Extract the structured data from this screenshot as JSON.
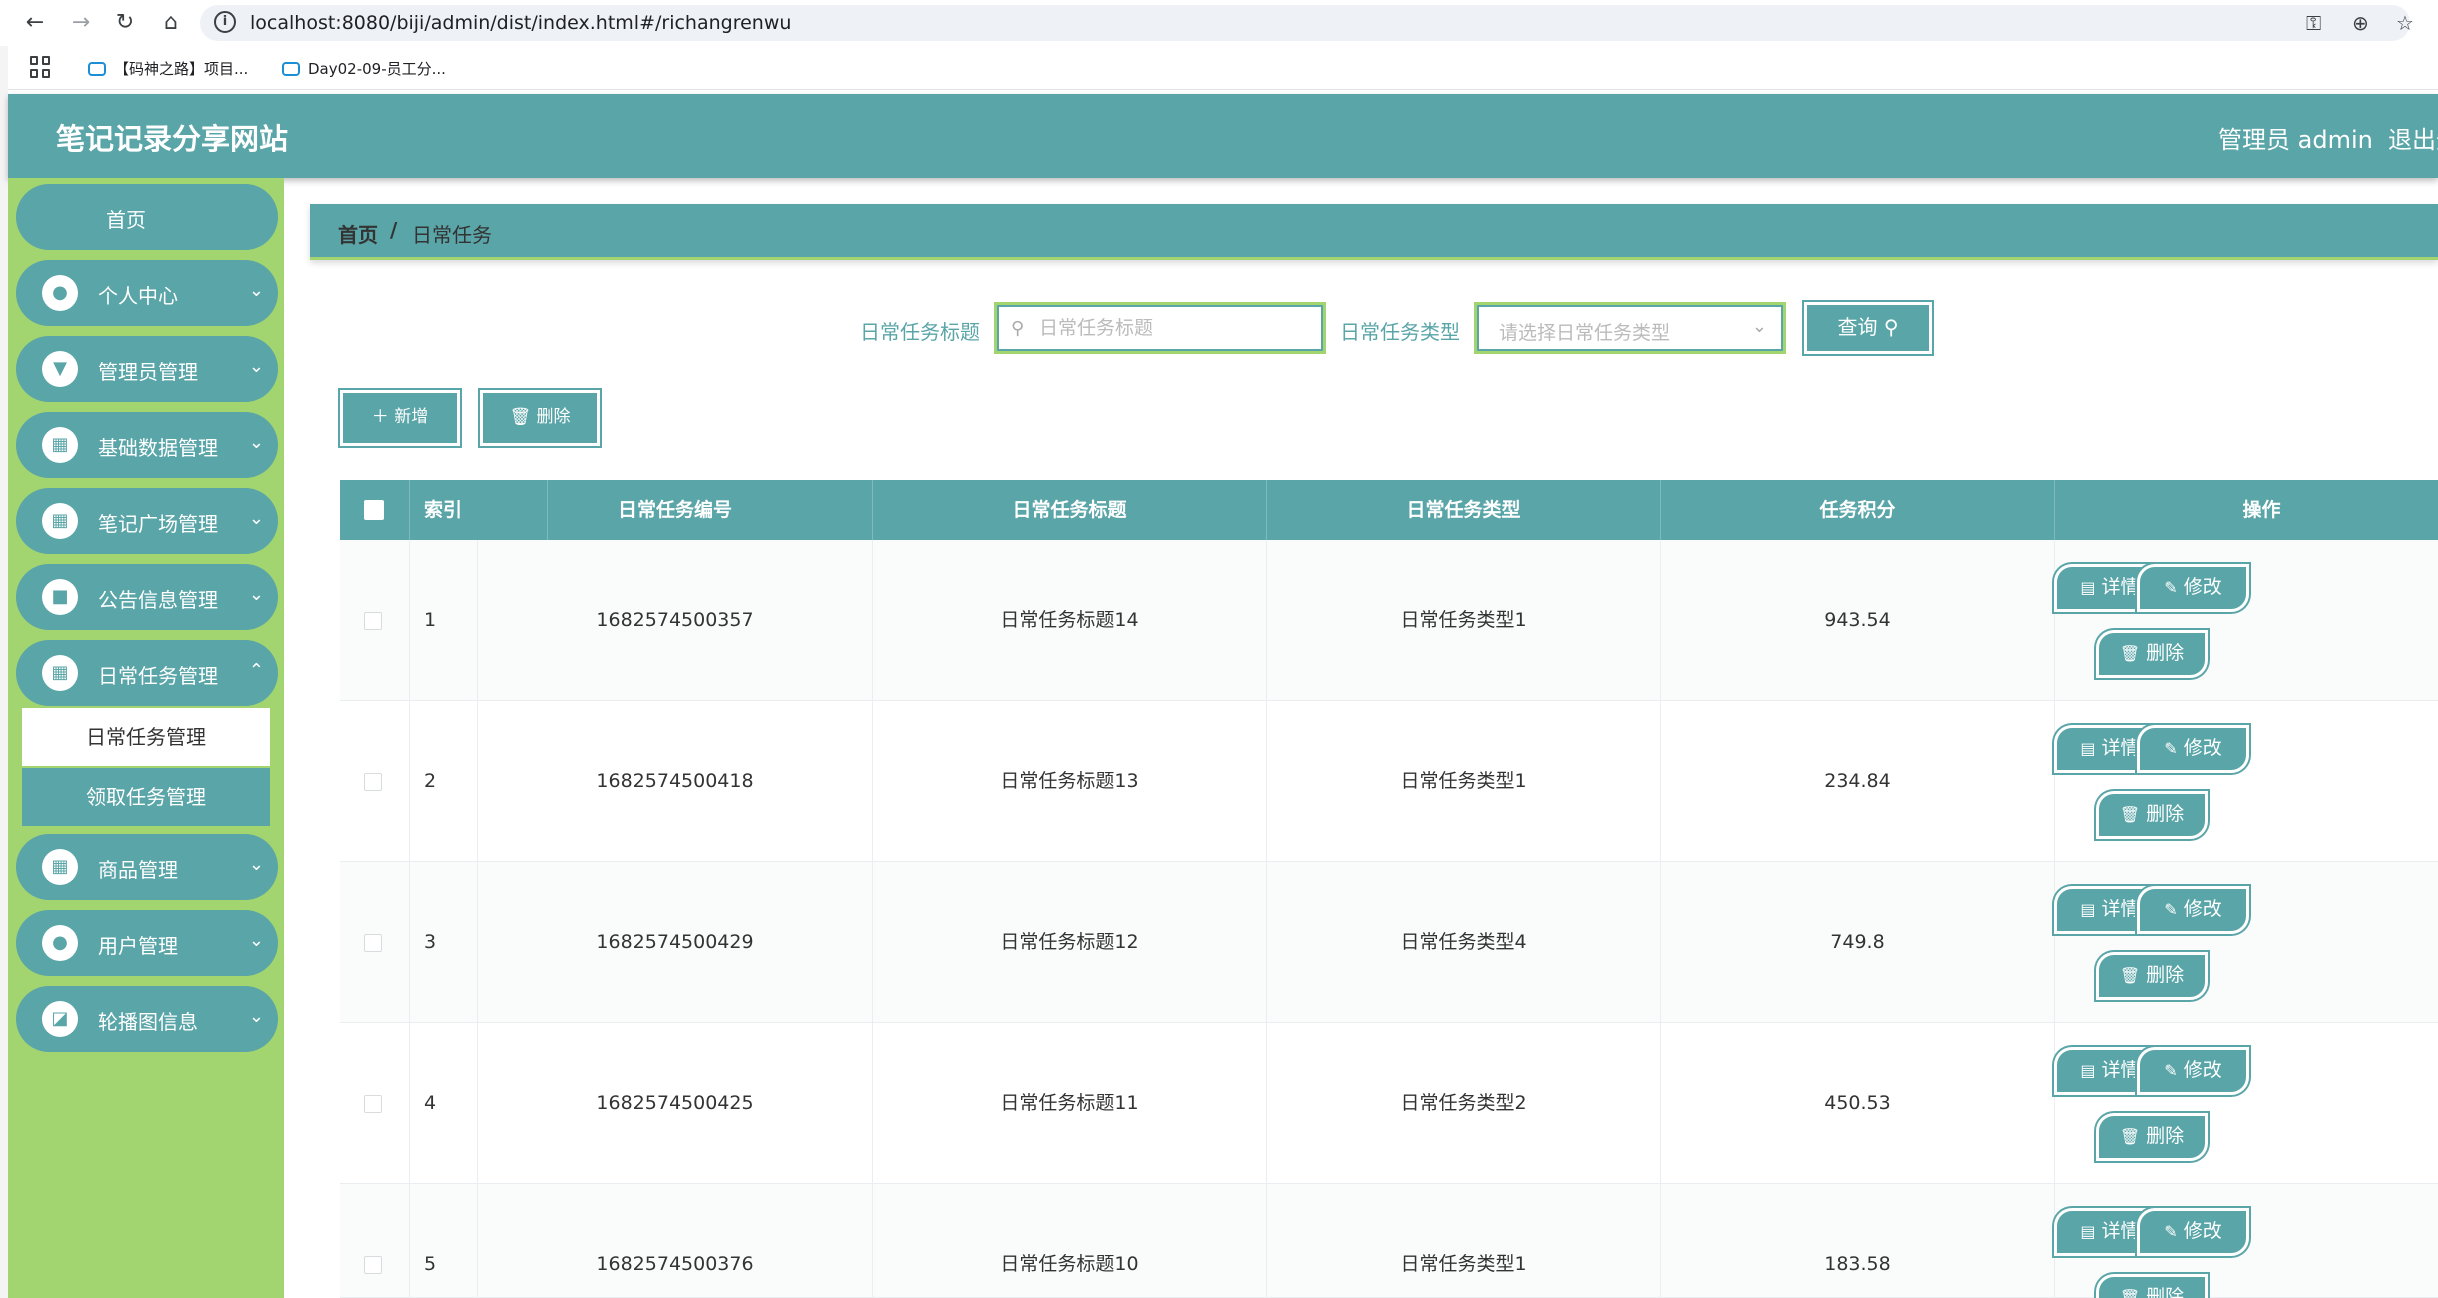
{
  "browser": {
    "url": "localhost:8080/biji/admin/dist/index.html#/richangrenwu",
    "bookmarks": [
      "【码神之路】项目...",
      "Day02-09-员工分..."
    ]
  },
  "header": {
    "site_title": "笔记记录分享网站",
    "admin_label": "管理员 admin",
    "logout": "退出登录"
  },
  "sidebar": {
    "home": "首页",
    "items": [
      {
        "label": "个人中心",
        "icon": "user-icon"
      },
      {
        "label": "管理员管理",
        "icon": "admin-icon"
      },
      {
        "label": "基础数据管理",
        "icon": "grid-icon"
      },
      {
        "label": "笔记广场管理",
        "icon": "grid-icon"
      },
      {
        "label": "公告信息管理",
        "icon": "notice-icon"
      },
      {
        "label": "日常任务管理",
        "icon": "grid-icon"
      },
      {
        "label": "商品管理",
        "icon": "grid-icon"
      },
      {
        "label": "用户管理",
        "icon": "user-icon"
      },
      {
        "label": "轮播图信息",
        "icon": "chart-icon"
      }
    ],
    "sub_items": [
      {
        "label": "日常任务管理",
        "active": true
      },
      {
        "label": "领取任务管理",
        "active": false
      }
    ]
  },
  "breadcrumb": {
    "home": "首页",
    "separator": "/",
    "current": "日常任务"
  },
  "search": {
    "title_label": "日常任务标题",
    "title_placeholder": "日常任务标题",
    "type_label": "日常任务类型",
    "type_placeholder": "请选择日常任务类型",
    "query_button": "查询"
  },
  "actions": {
    "add": "新增",
    "delete": "删除"
  },
  "table": {
    "columns": [
      "索引",
      "日常任务编号",
      "日常任务标题",
      "日常任务类型",
      "任务积分",
      "操作"
    ],
    "rows": [
      {
        "index": "1",
        "code": "1682574500357",
        "title": "日常任务标题14",
        "type": "日常任务类型1",
        "points": "943.54"
      },
      {
        "index": "2",
        "code": "1682574500418",
        "title": "日常任务标题13",
        "type": "日常任务类型1",
        "points": "234.84"
      },
      {
        "index": "3",
        "code": "1682574500429",
        "title": "日常任务标题12",
        "type": "日常任务类型4",
        "points": "749.8"
      },
      {
        "index": "4",
        "code": "1682574500425",
        "title": "日常任务标题11",
        "type": "日常任务类型2",
        "points": "450.53"
      },
      {
        "index": "5",
        "code": "1682574500376",
        "title": "日常任务标题10",
        "type": "日常任务类型1",
        "points": "183.58"
      }
    ],
    "row_buttons": {
      "detail": "详情",
      "edit": "修改",
      "delete": "删除"
    }
  },
  "colors": {
    "primary": "#5aa5a8",
    "sidebar_bg": "#a2d470"
  }
}
